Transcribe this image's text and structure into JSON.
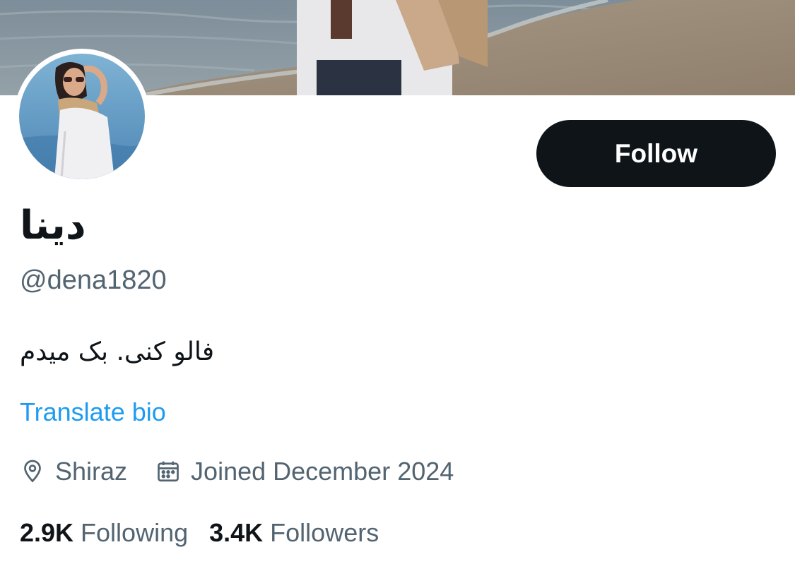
{
  "profile": {
    "display_name": "دينا",
    "handle": "@dena1820",
    "bio": "فالو کنی. بک میدم",
    "translate_bio_label": "Translate bio",
    "location": "Shiraz",
    "joined": "Joined December 2024",
    "following_count": "2.9K",
    "following_label": "Following",
    "followers_count": "3.4K",
    "followers_label": "Followers"
  },
  "actions": {
    "follow_label": "Follow"
  },
  "colors": {
    "text_primary": "#0f1419",
    "text_secondary": "#536471",
    "link_blue": "#1d9bf0",
    "follow_button_bg": "#0f1419"
  },
  "icons": {
    "location": "location-pin-icon",
    "joined": "calendar-icon"
  }
}
